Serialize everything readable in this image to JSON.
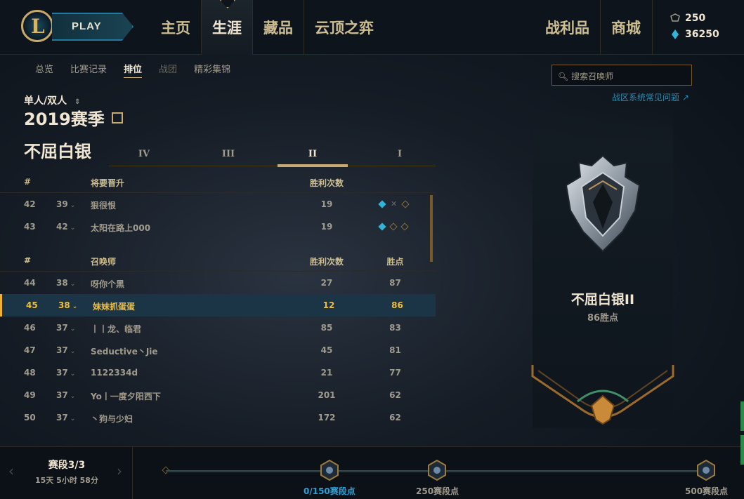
{
  "topbar": {
    "play_label": "PLAY",
    "nav": [
      "主页",
      "生涯",
      "藏品",
      "云顶之弈"
    ],
    "nav_right": [
      "战利品",
      "商城"
    ],
    "active_nav": "生涯",
    "currency": {
      "rp": "250",
      "be": "36250"
    }
  },
  "subnav": {
    "items": [
      "总览",
      "比赛记录",
      "排位",
      "战团",
      "精彩集锦"
    ],
    "active": "排位"
  },
  "search": {
    "placeholder": "搜索召唤师"
  },
  "faq_link": "战区系统常见问题 ↗",
  "queue_label": "单人/双人",
  "season_label": "2019赛季",
  "tier_title": "不屈白银",
  "divisions": {
    "labels": [
      "IV",
      "III",
      "II",
      "I"
    ],
    "active": "II"
  },
  "promo_table": {
    "headers": {
      "rank": "#",
      "name": "将要晋升",
      "wins": "胜利次数"
    },
    "rows": [
      {
        "rank": "42",
        "lp_rank": "39",
        "name": "狠很恨",
        "wins": "19",
        "series": [
          "win",
          "loss",
          "pending"
        ]
      },
      {
        "rank": "43",
        "lp_rank": "42",
        "name": "太阳在路上000",
        "wins": "19",
        "series": [
          "win",
          "pending",
          "pending"
        ]
      }
    ]
  },
  "ladder_table": {
    "headers": {
      "rank": "#",
      "name": "召唤师",
      "wins": "胜利次数",
      "points": "胜点"
    },
    "rows": [
      {
        "rank": "44",
        "lp_rank": "38",
        "name": "呀你个黑",
        "wins": "27",
        "points": "87",
        "me": false
      },
      {
        "rank": "45",
        "lp_rank": "38",
        "name": "妹妹抓蛋蛋",
        "wins": "12",
        "points": "86",
        "me": true
      },
      {
        "rank": "46",
        "lp_rank": "37",
        "name": "丨丨龙、临君",
        "wins": "85",
        "points": "83",
        "me": false
      },
      {
        "rank": "47",
        "lp_rank": "37",
        "name": "Seductive丶Jie",
        "wins": "45",
        "points": "81",
        "me": false
      },
      {
        "rank": "48",
        "lp_rank": "37",
        "name": "1122334d",
        "wins": "21",
        "points": "77",
        "me": false
      },
      {
        "rank": "49",
        "lp_rank": "37",
        "name": "Yo丨一度夕阳西下",
        "wins": "201",
        "points": "62",
        "me": false
      },
      {
        "rank": "50",
        "lp_rank": "37",
        "name": "丶狗与少妇",
        "wins": "172",
        "points": "62",
        "me": false
      }
    ]
  },
  "rank_banner": {
    "name": "不屈白银II",
    "lp": "86胜点"
  },
  "segment": {
    "title": "赛段3/3",
    "time_left": "15天 5小时 58分",
    "markers": [
      {
        "label": "0/150赛段点",
        "current": true
      },
      {
        "label": "250赛段点",
        "current": false
      },
      {
        "label": "500赛段点",
        "current": false
      }
    ]
  },
  "colors": {
    "gold": "#c8aa6e",
    "highlight": "#f0bd3a",
    "blue": "#2b9fd6",
    "background": "#0a1017"
  }
}
